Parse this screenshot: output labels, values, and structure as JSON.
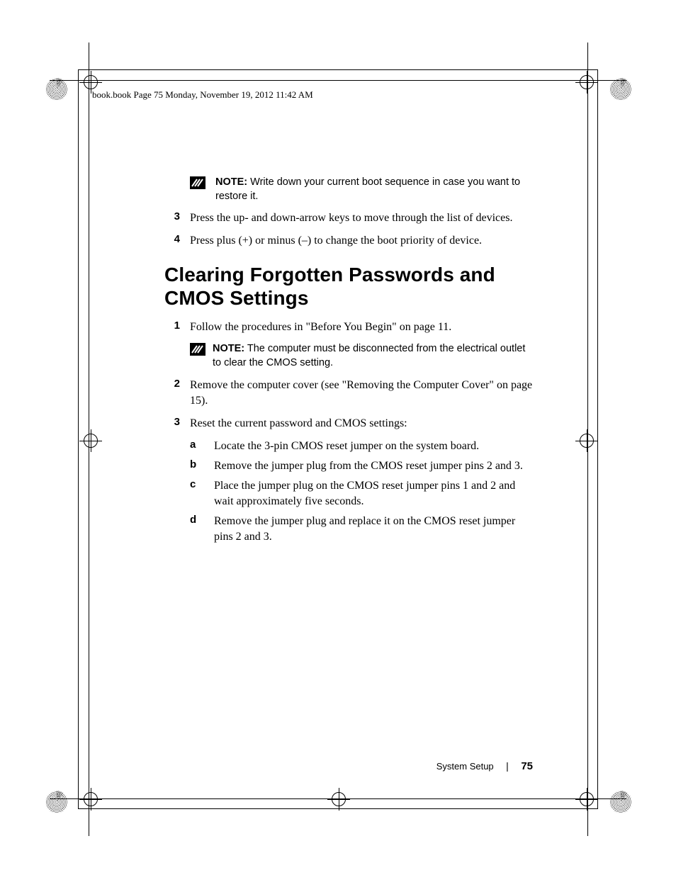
{
  "header": {
    "running": "book.book  Page 75  Monday, November 19, 2012  11:42 AM"
  },
  "notes": {
    "label": "NOTE:",
    "n1": "Write down your current boot sequence in case you want to restore it.",
    "n2": "The computer must be disconnected from the electrical outlet to clear the CMOS setting."
  },
  "top_steps": {
    "s3": {
      "num": "3",
      "text": "Press the up- and down-arrow keys to move through the list of devices."
    },
    "s4": {
      "num": "4",
      "text": "Press plus (+) or minus (–) to change the boot priority of device."
    }
  },
  "section": {
    "title": "Clearing Forgotten Passwords and CMOS Settings"
  },
  "steps": {
    "s1": {
      "num": "1",
      "text": "Follow the procedures in \"Before You Begin\" on page 11."
    },
    "s2": {
      "num": "2",
      "text": "Remove the computer cover (see \"Removing the Computer Cover\" on page 15)."
    },
    "s3": {
      "num": "3",
      "text": "Reset the current password and CMOS settings:"
    }
  },
  "substeps": {
    "a": {
      "letter": "a",
      "text": "Locate the 3-pin CMOS reset jumper on the system board."
    },
    "b": {
      "letter": "b",
      "text": "Remove the jumper plug from the CMOS reset jumper pins 2 and 3."
    },
    "c": {
      "letter": "c",
      "text": "Place the jumper plug on the CMOS reset jumper pins 1 and 2 and wait approximately five seconds."
    },
    "d": {
      "letter": "d",
      "text": "Remove the jumper plug and replace it on the CMOS reset jumper pins 2 and 3."
    }
  },
  "footer": {
    "section": "System Setup",
    "separator": "|",
    "page": "75"
  }
}
